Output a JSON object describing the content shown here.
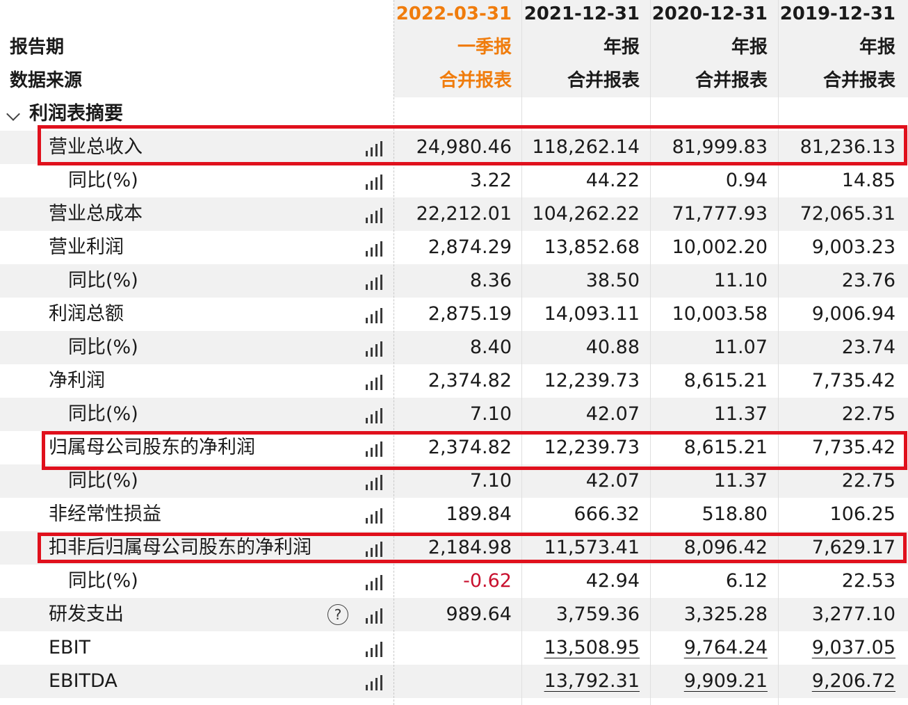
{
  "header": {
    "periods": [
      "2022-03-31",
      "2021-12-31",
      "2020-12-31",
      "2019-12-31"
    ],
    "report_period_label": "报告期",
    "report_types": [
      "一季报",
      "年报",
      "年报",
      "年报"
    ],
    "data_source_label": "数据来源",
    "data_sources": [
      "合并报表",
      "合并报表",
      "合并报表",
      "合并报表"
    ]
  },
  "section": {
    "title": "利润表摘要"
  },
  "rows": [
    {
      "label": "营业总收入",
      "values": [
        "24,980.46",
        "118,262.14",
        "81,999.83",
        "81,236.13"
      ]
    },
    {
      "label": "同比(%)",
      "values": [
        "3.22",
        "44.22",
        "0.94",
        "14.85"
      ]
    },
    {
      "label": "营业总成本",
      "values": [
        "22,212.01",
        "104,262.22",
        "71,777.93",
        "72,065.31"
      ]
    },
    {
      "label": "营业利润",
      "values": [
        "2,874.29",
        "13,852.68",
        "10,002.20",
        "9,003.23"
      ]
    },
    {
      "label": "同比(%)",
      "values": [
        "8.36",
        "38.50",
        "11.10",
        "23.76"
      ]
    },
    {
      "label": "利润总额",
      "values": [
        "2,875.19",
        "14,093.11",
        "10,003.58",
        "9,006.94"
      ]
    },
    {
      "label": "同比(%)",
      "values": [
        "8.40",
        "40.88",
        "11.07",
        "23.74"
      ]
    },
    {
      "label": "净利润",
      "values": [
        "2,374.82",
        "12,239.73",
        "8,615.21",
        "7,735.42"
      ]
    },
    {
      "label": "同比(%)",
      "values": [
        "7.10",
        "42.07",
        "11.37",
        "22.75"
      ]
    },
    {
      "label": "归属母公司股东的净利润",
      "values": [
        "2,374.82",
        "12,239.73",
        "8,615.21",
        "7,735.42"
      ]
    },
    {
      "label": "同比(%)",
      "values": [
        "7.10",
        "42.07",
        "11.37",
        "22.75"
      ]
    },
    {
      "label": "非经常性损益",
      "values": [
        "189.84",
        "666.32",
        "518.80",
        "106.25"
      ]
    },
    {
      "label": "扣非后归属母公司股东的净利润",
      "values": [
        "2,184.98",
        "11,573.41",
        "8,096.42",
        "7,629.17"
      ]
    },
    {
      "label": "同比(%)",
      "values": [
        "-0.62",
        "42.94",
        "6.12",
        "22.53"
      ]
    },
    {
      "label": "研发支出",
      "help": "?",
      "values": [
        "989.64",
        "3,759.36",
        "3,325.28",
        "3,277.10"
      ]
    },
    {
      "label": "EBIT",
      "values": [
        "",
        "13,508.95",
        "9,764.24",
        "9,037.05"
      ]
    },
    {
      "label": "EBITDA",
      "values": [
        "",
        "13,792.31",
        "9,909.21",
        "9,206.72"
      ]
    }
  ],
  "colors": {
    "accent": "#f07c0c",
    "negative": "#c8102e",
    "highlight_box": "#e0101c",
    "shaded_row": "#f1f1f1"
  }
}
